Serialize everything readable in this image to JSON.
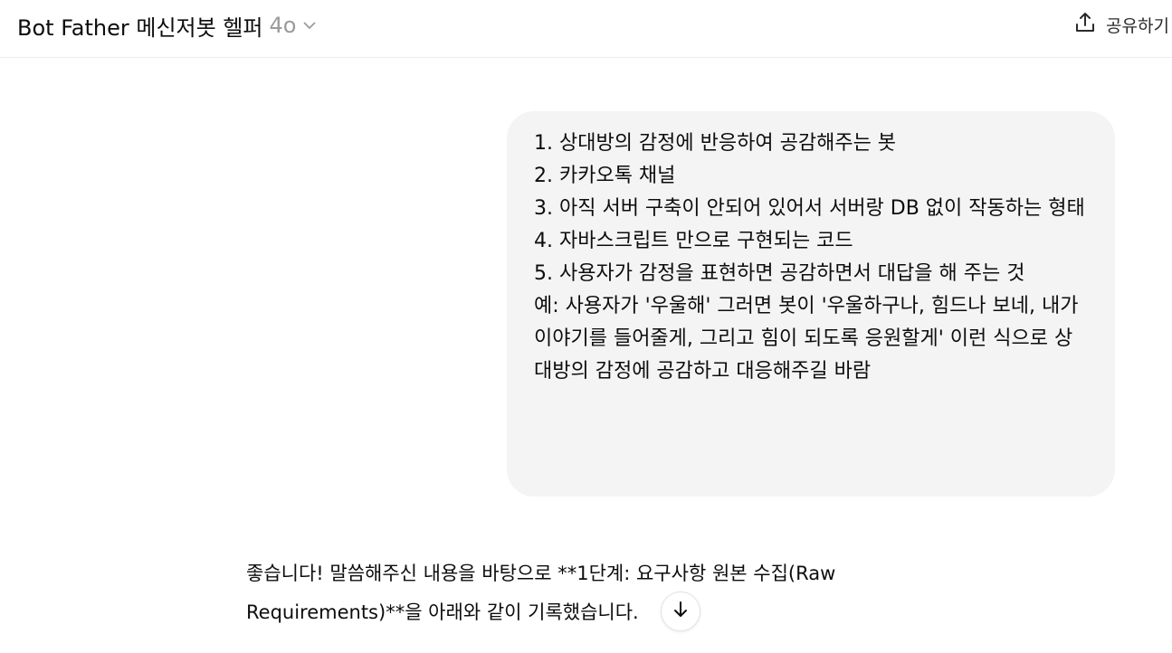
{
  "header": {
    "title": "Bot Father 메신저봇 헬퍼",
    "model": "4o",
    "share_label": "공유하기"
  },
  "conversation": {
    "user_message": "1. 상대방의 감정에 반응하여 공감해주는 봇\n2. 카카오톡 채널\n3. 아직 서버 구축이 안되어 있어서 서버랑 DB 없이 작동하는 형태\n4. 자바스크립트 만으로 구현되는 코드\n5. 사용자가 감정을 표현하면 공감하면서 대답을 해 주는 것\n예: 사용자가 '우울해' 그러면 봇이 '우울하구나, 힘드나 보네, 내가 이야기를 들어줄게, 그리고 힘이 되도록 응원할게' 이런 식으로 상대방의 감정에 공감하고 대응해주길 바람",
    "assistant_message": "좋습니다! 말씀해주신 내용을 바탕으로 **1단계: 요구사항 원본 수집(Raw Requirements)**을 아래와 같이 기록했습니다."
  },
  "icons": {
    "model_dropdown": "chevron-down-icon",
    "share": "share-icon",
    "scroll_down": "arrow-down-icon"
  }
}
